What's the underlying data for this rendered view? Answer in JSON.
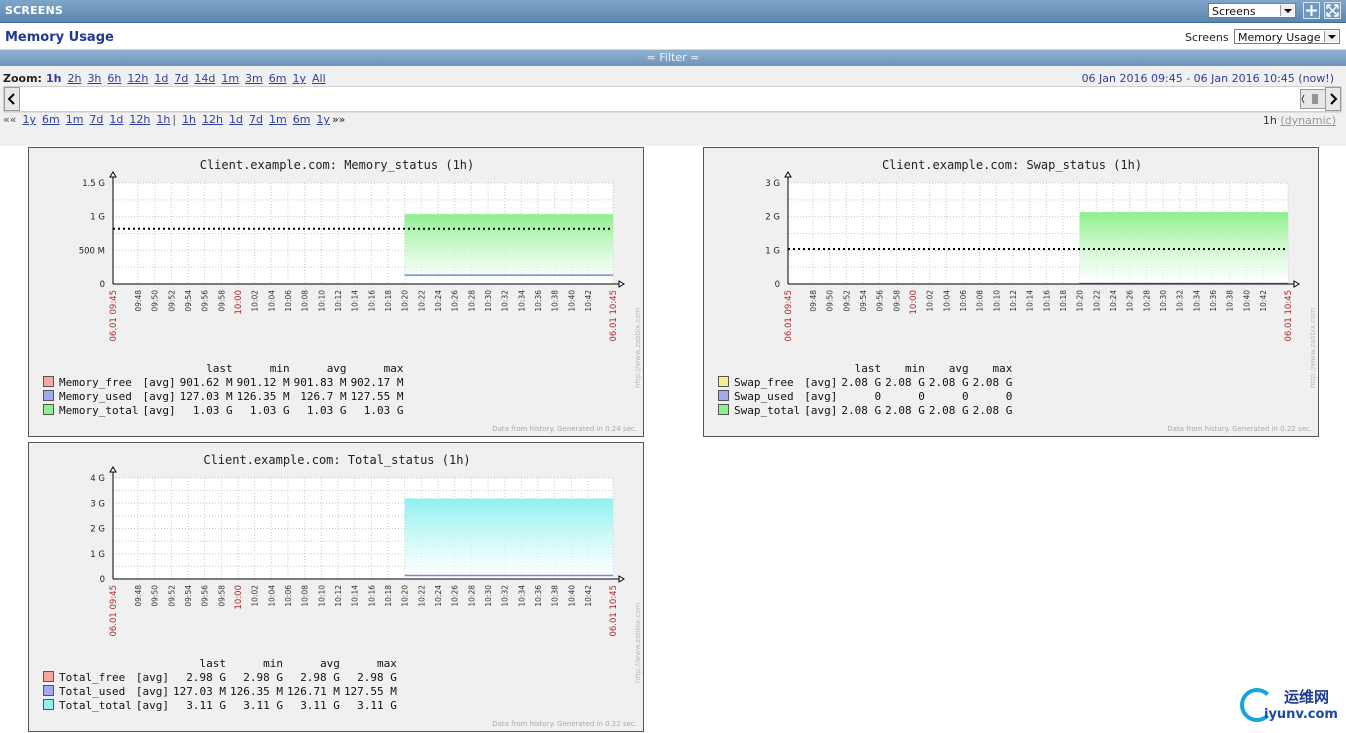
{
  "header": {
    "title": "SCREENS",
    "select_label": "Screens"
  },
  "subheader": {
    "page_title": "Memory Usage",
    "screens_label": "Screens",
    "screen_select": "Memory Usage"
  },
  "filter": {
    "label": "≈ Filter ≈"
  },
  "zoom": {
    "label": "Zoom:",
    "current": "1h",
    "options": [
      "2h",
      "3h",
      "6h",
      "12h",
      "1d",
      "7d",
      "14d",
      "1m",
      "3m",
      "6m",
      "1y",
      "All"
    ],
    "period": "06 Jan 2016 09:45  -  06 Jan 2016 10:45 (now!)"
  },
  "nav": {
    "back_prefix": "««",
    "back": [
      "1y",
      "6m",
      "1m",
      "7d",
      "1d",
      "12h",
      "1h"
    ],
    "separator": "|",
    "forward": [
      "1h",
      "12h",
      "1d",
      "7d",
      "1m",
      "6m",
      "1y"
    ],
    "forward_suffix": "»»",
    "period_label": "1h",
    "dynamic_label": "(dynamic)"
  },
  "graphs": [
    {
      "title": "Client.example.com: Memory_status (1h)",
      "footer": "Data from history. Generated in 0.24 sec.",
      "side_text": "http://www.zabbix.com",
      "legend_headers": [
        "last",
        "min",
        "avg",
        "max"
      ],
      "legend": [
        {
          "name": "Memory_free",
          "func": "[avg]",
          "last": "901.62 M",
          "min": "901.12 M",
          "avg": "901.83 M",
          "max": "902.17 M",
          "color": "#f4a8a2"
        },
        {
          "name": "Memory_used",
          "func": "[avg]",
          "last": "127.03 M",
          "min": "126.35 M",
          "avg": "126.7 M",
          "max": "127.55 M",
          "color": "#a4a8f0"
        },
        {
          "name": "Memory_total",
          "func": "[avg]",
          "last": "1.03 G",
          "min": "1.03 G",
          "avg": "1.03 G",
          "max": "1.03 G",
          "color": "#8ef08e"
        }
      ]
    },
    {
      "title": "Client.example.com: Swap_status (1h)",
      "footer": "Data from history. Generated in 0.22 sec.",
      "side_text": "http://www.zabbix.com",
      "legend_headers": [
        "last",
        "min",
        "avg",
        "max"
      ],
      "legend": [
        {
          "name": "Swap_free",
          "func": "[avg]",
          "last": "2.08 G",
          "min": "2.08 G",
          "avg": "2.08 G",
          "max": "2.08 G",
          "color": "#f2f28c"
        },
        {
          "name": "Swap_used",
          "func": "[avg]",
          "last": "0",
          "min": "0",
          "avg": "0",
          "max": "0",
          "color": "#a4a8f0"
        },
        {
          "name": "Swap_total",
          "func": "[avg]",
          "last": "2.08 G",
          "min": "2.08 G",
          "avg": "2.08 G",
          "max": "2.08 G",
          "color": "#8ef08e"
        }
      ]
    },
    {
      "title": "Client.example.com: Total_status (1h)",
      "footer": "Data from history. Generated in 0.22 sec.",
      "side_text": "http://www.zabbix.com",
      "legend_headers": [
        "last",
        "min",
        "avg",
        "max"
      ],
      "legend": [
        {
          "name": "Total_free",
          "func": "[avg]",
          "last": "2.98 G",
          "min": "2.98 G",
          "avg": "2.98 G",
          "max": "2.98 G",
          "color": "#f4a8a2"
        },
        {
          "name": "Total_used",
          "func": "[avg]",
          "last": "127.03 M",
          "min": "126.35 M",
          "avg": "126.71 M",
          "max": "127.55 M",
          "color": "#a4a8f0"
        },
        {
          "name": "Total_total",
          "func": "[avg]",
          "last": "3.11 G",
          "min": "3.11 G",
          "avg": "3.11 G",
          "max": "3.11 G",
          "color": "#8ef0f0"
        }
      ]
    }
  ],
  "chart_data": [
    {
      "type": "area",
      "title": "Client.example.com: Memory_status (1h)",
      "x": [
        "06.01 09:45",
        "09:48",
        "09:50",
        "09:52",
        "09:54",
        "09:56",
        "09:58",
        "10:00",
        "10:02",
        "10:04",
        "10:06",
        "10:08",
        "10:10",
        "10:12",
        "10:14",
        "10:16",
        "10:18",
        "10:20",
        "10:22",
        "10:24",
        "10:26",
        "10:28",
        "10:30",
        "10:32",
        "10:34",
        "10:36",
        "10:38",
        "10:40",
        "10:42",
        "06.01 10:45"
      ],
      "x_red": [
        "06.01 09:45",
        "10:00",
        "06.01 10:45"
      ],
      "y_ticks": [
        "0",
        "500 M",
        "1 G",
        "1.5 G"
      ],
      "ylim_mb": [
        0,
        1536
      ],
      "data_start": "10:20",
      "series": [
        {
          "name": "Memory_total",
          "values_mb": 1055,
          "color": "#8ef08e"
        },
        {
          "name": "Memory_used",
          "values_mb": 127,
          "color": "#7e82e0"
        }
      ],
      "trigger_line_mb": 840,
      "grid": true
    },
    {
      "type": "area",
      "title": "Client.example.com: Swap_status (1h)",
      "x": [
        "06.01 09:45",
        "09:48",
        "09:50",
        "09:52",
        "09:54",
        "09:56",
        "09:58",
        "10:00",
        "10:02",
        "10:04",
        "10:06",
        "10:08",
        "10:10",
        "10:12",
        "10:14",
        "10:16",
        "10:18",
        "10:20",
        "10:22",
        "10:24",
        "10:26",
        "10:28",
        "10:30",
        "10:32",
        "10:34",
        "10:36",
        "10:38",
        "10:40",
        "10:42",
        "06.01 10:45"
      ],
      "x_red": [
        "06.01 09:45",
        "10:00",
        "06.01 10:45"
      ],
      "y_ticks": [
        "0",
        "1 G",
        "2 G",
        "3 G"
      ],
      "ylim_gb": [
        0,
        3
      ],
      "data_start": "10:20",
      "series": [
        {
          "name": "Swap_total",
          "values_gb": 2.12,
          "color": "#8ef08e"
        },
        {
          "name": "Swap_used",
          "values_gb": 0,
          "color": "#7e82e0"
        }
      ],
      "trigger_line_gb": 1.04,
      "grid": true
    },
    {
      "type": "area",
      "title": "Client.example.com: Total_status (1h)",
      "x": [
        "06.01 09:45",
        "09:48",
        "09:50",
        "09:52",
        "09:54",
        "09:56",
        "09:58",
        "10:00",
        "10:02",
        "10:04",
        "10:06",
        "10:08",
        "10:10",
        "10:12",
        "10:14",
        "10:16",
        "10:18",
        "10:20",
        "10:22",
        "10:24",
        "10:26",
        "10:28",
        "10:30",
        "10:32",
        "10:34",
        "10:36",
        "10:38",
        "10:40",
        "10:42",
        "06.01 10:45"
      ],
      "x_red": [
        "06.01 09:45",
        "10:00",
        "06.01 10:45"
      ],
      "y_ticks": [
        "0",
        "1 G",
        "2 G",
        "3 G",
        "4 G"
      ],
      "ylim_gb": [
        0,
        4
      ],
      "data_start": "10:20",
      "series": [
        {
          "name": "Total_total",
          "values_gb": 3.17,
          "color": "#8ef0f0"
        },
        {
          "name": "Total_used",
          "values_gb": 0.12,
          "color": "#7e82e0"
        }
      ],
      "grid": true
    }
  ],
  "watermark": {
    "cn": "运维网",
    "en": "iyunv.com"
  }
}
